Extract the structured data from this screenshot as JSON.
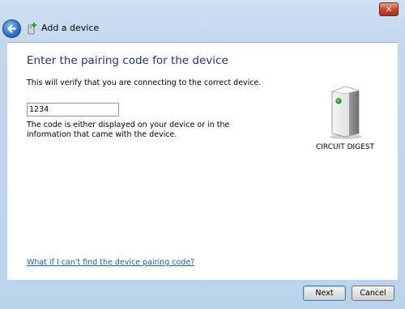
{
  "window": {
    "title": "Add a device",
    "close_label": "✕",
    "colors": {
      "background": "#c3d7ee",
      "heading": "#1e3287",
      "link": "#1c5ea8"
    }
  },
  "page": {
    "heading": "Enter the pairing code for the device",
    "description": "This will verify that you are connecting to the correct device.",
    "code_value": "1234",
    "hint": "The code is either displayed on your device or in the information that came with the device.",
    "device_caption": "CIRCUIT DIGEST",
    "help_link": "What if I can't find the device pairing code?"
  },
  "buttons": {
    "next": "Next",
    "cancel": "Cancel"
  },
  "icons": {
    "back": "back-arrow-icon",
    "title": "device-add-icon",
    "device": "device-tower-icon"
  }
}
